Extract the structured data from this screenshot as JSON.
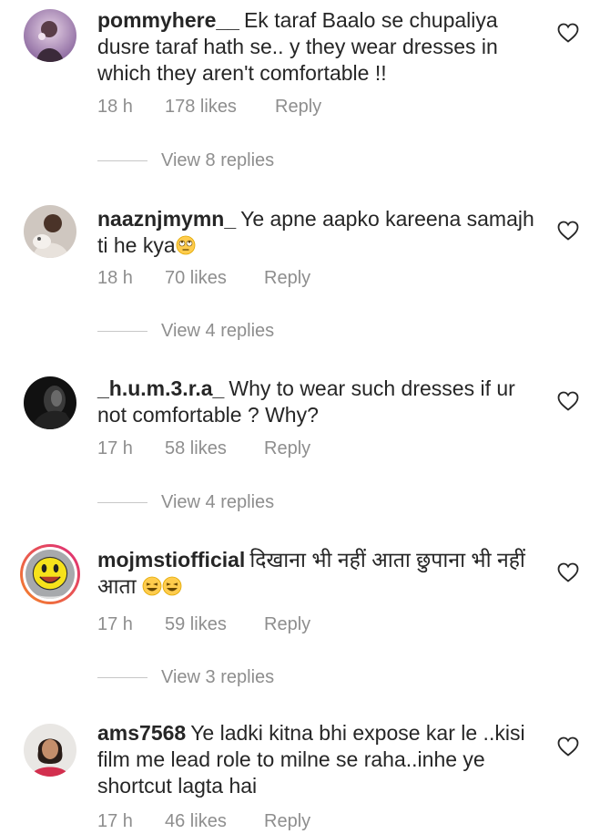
{
  "comments": [
    {
      "username": "pommyhere__",
      "text": "Ek taraf Baalo se chupaliya dusre taraf hath se.. y they wear dresses in which they aren't comfortable !!",
      "time": "18 h",
      "likes": "178 likes",
      "reply": "Reply",
      "view_replies": "View 8 replies",
      "avatar_icon": "avatar-photo-icon"
    },
    {
      "username": "naaznjmymn_",
      "text": "Ye apne aapko kareena samajh ti he kya",
      "emoji": "rolling-eyes-emoji",
      "time": "18 h",
      "likes": "70 likes",
      "reply": "Reply",
      "view_replies": "View 4 replies",
      "avatar_icon": "avatar-photo-icon"
    },
    {
      "username": "_h.u.m.3.r.a_",
      "text": "Why to wear such dresses if ur not comfortable ? Why?",
      "time": "17 h",
      "likes": "58 likes",
      "reply": "Reply",
      "view_replies": "View 4 replies",
      "avatar_icon": "avatar-photo-icon"
    },
    {
      "username": "mojmstiofficial",
      "text": "दिखाना भी नहीं आता छुपाना भी नहीं आता",
      "emoji": "laughing-emoji",
      "time": "17 h",
      "likes": "59 likes",
      "reply": "Reply",
      "view_replies": "View 3 replies",
      "avatar_icon": "smiley-avatar-icon"
    },
    {
      "username": "ams7568",
      "text": "Ye ladki kitna bhi expose kar le ..kisi film me lead role to milne se raha..inhe ye shortcut lagta hai",
      "time": "17 h",
      "likes": "46 likes",
      "reply": "Reply",
      "avatar_icon": "avatar-photo-icon"
    }
  ],
  "colors": {
    "text": "#262626",
    "meta": "#8e8e8e",
    "story_ring_start": "#f58529",
    "story_ring_end": "#dd2a7b"
  }
}
